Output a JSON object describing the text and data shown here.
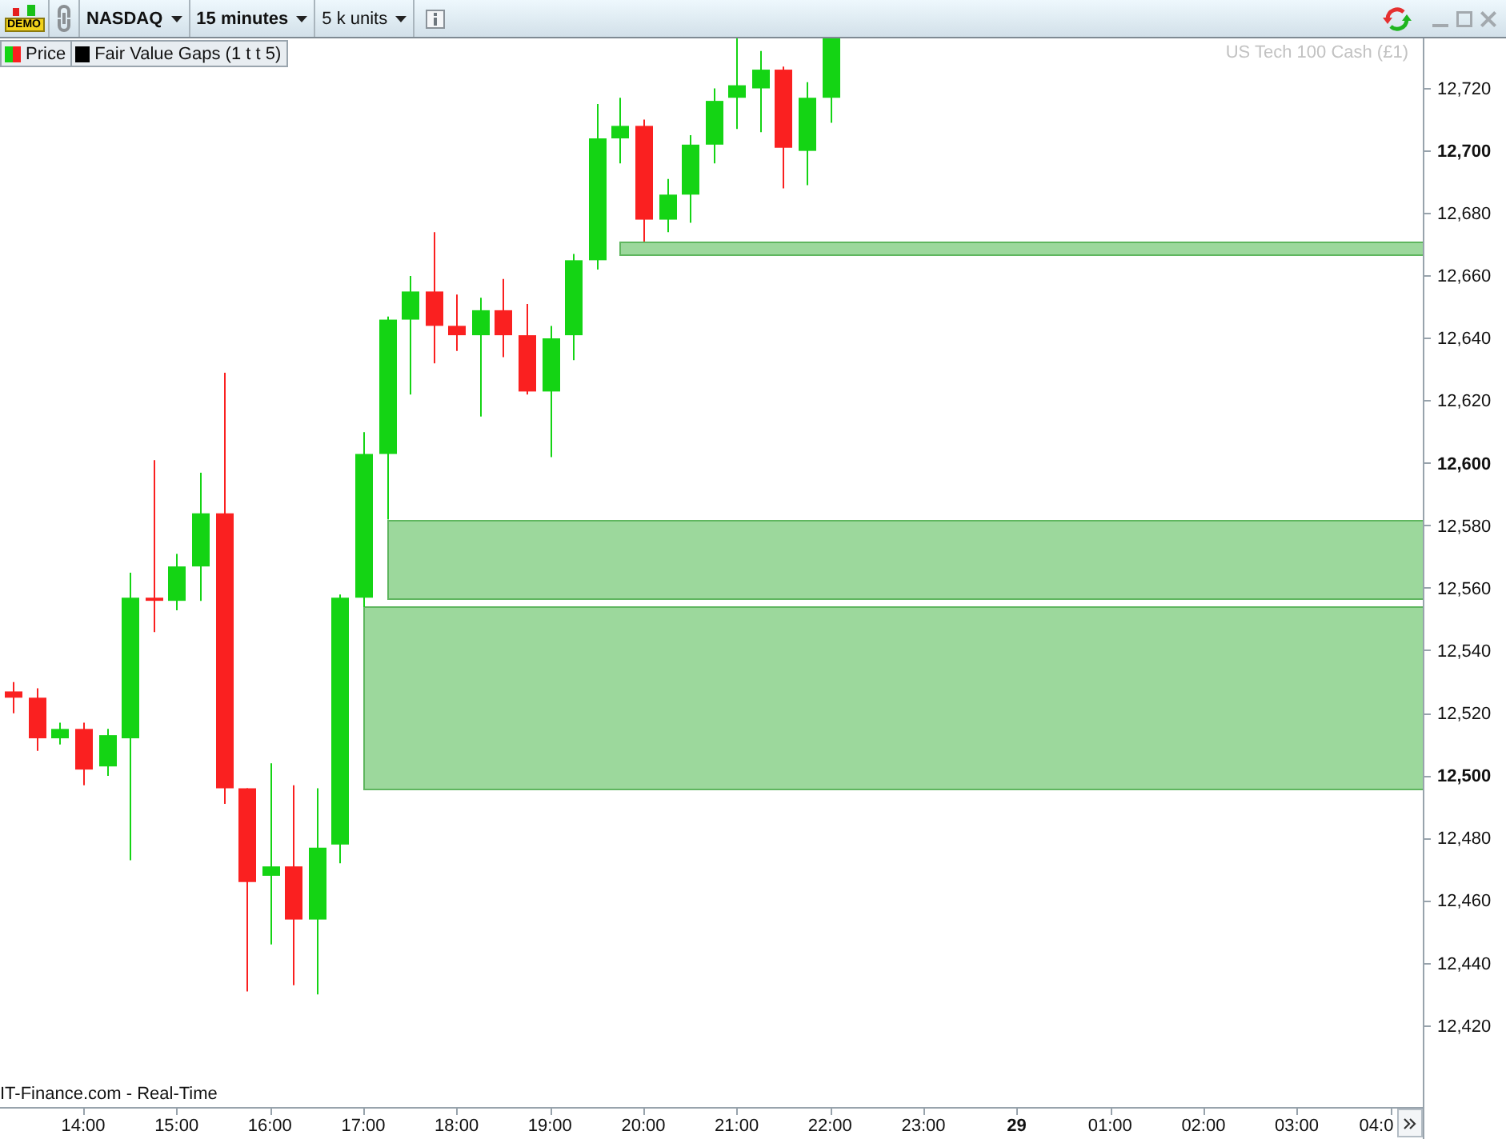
{
  "toolbar": {
    "logo": {
      "text": "DEMO"
    },
    "selectors": [
      {
        "label": "NASDAQ",
        "bold": true
      },
      {
        "label": "15 minutes",
        "bold": true
      },
      {
        "label": "5 k units",
        "bold": false
      }
    ]
  },
  "legend": [
    {
      "label": "Price",
      "kind": "split"
    },
    {
      "label": "Fair Value Gaps (1 t t 5)",
      "kind": "solid",
      "color": "#000000"
    }
  ],
  "instrument_label": "US Tech 100 Cash (£1)",
  "price_axis": {
    "labels": [
      {
        "text": "12,720",
        "kind": "minor"
      },
      {
        "text": "12,700",
        "kind": "major"
      },
      {
        "text": "12,680",
        "kind": "minor"
      },
      {
        "text": "12,660",
        "kind": "minor"
      },
      {
        "text": "12,640",
        "kind": "minor"
      },
      {
        "text": "12,620",
        "kind": "minor"
      },
      {
        "text": "12,600",
        "kind": "major"
      },
      {
        "text": "12,580",
        "kind": "minor"
      },
      {
        "text": "12,560",
        "kind": "minor"
      },
      {
        "text": "12,540",
        "kind": "minor"
      },
      {
        "text": "12,520",
        "kind": "minor"
      },
      {
        "text": "12,500",
        "kind": "major"
      },
      {
        "text": "12,480",
        "kind": "minor"
      },
      {
        "text": "12,460",
        "kind": "minor"
      },
      {
        "text": "12,440",
        "kind": "minor"
      },
      {
        "text": "12,420",
        "kind": "minor"
      }
    ]
  },
  "time_axis": {
    "labels": [
      {
        "text": "14:00",
        "kind": "hour"
      },
      {
        "text": "15:00",
        "kind": "hour"
      },
      {
        "text": "16:00",
        "kind": "hour"
      },
      {
        "text": "17:00",
        "kind": "hour"
      },
      {
        "text": "18:00",
        "kind": "hour"
      },
      {
        "text": "19:00",
        "kind": "hour"
      },
      {
        "text": "20:00",
        "kind": "hour"
      },
      {
        "text": "21:00",
        "kind": "hour"
      },
      {
        "text": "22:00",
        "kind": "hour"
      },
      {
        "text": "23:00",
        "kind": "hour"
      },
      {
        "text": "29",
        "kind": "day"
      },
      {
        "text": "01:00",
        "kind": "hour"
      },
      {
        "text": "02:00",
        "kind": "hour"
      },
      {
        "text": "03:00",
        "kind": "hour"
      },
      {
        "text": "04:0",
        "kind": "hour"
      }
    ]
  },
  "data_source": "IT-Finance.com - Real-Time"
}
